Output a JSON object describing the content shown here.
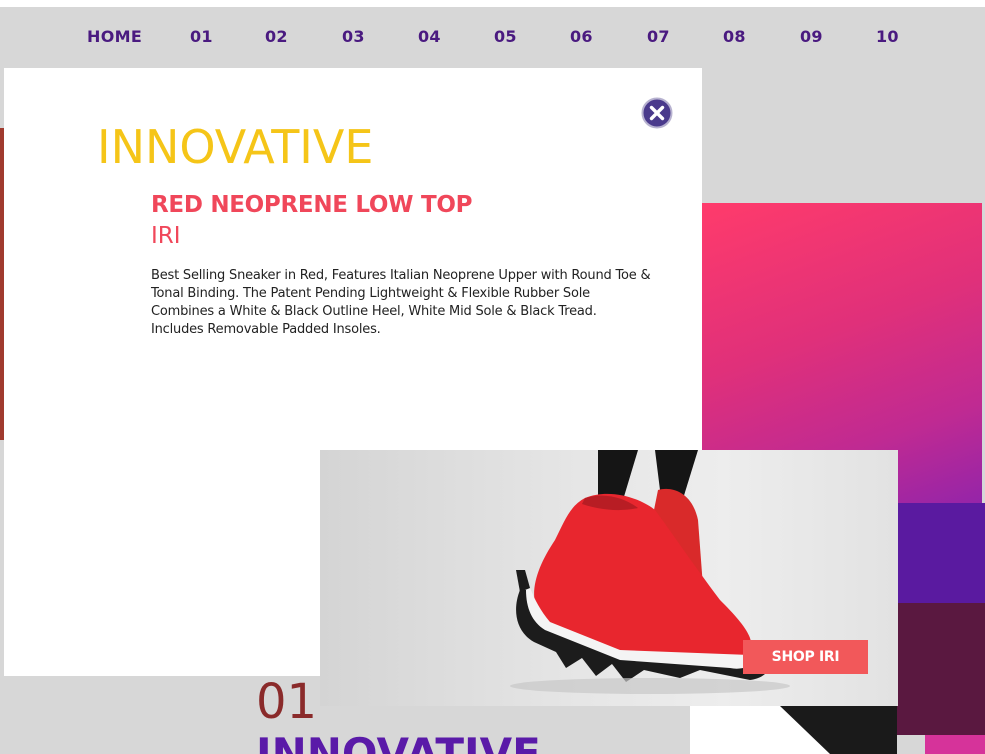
{
  "nav": {
    "items": [
      {
        "label": "HOME"
      },
      {
        "label": "01"
      },
      {
        "label": "02"
      },
      {
        "label": "03"
      },
      {
        "label": "04"
      },
      {
        "label": "05"
      },
      {
        "label": "06"
      },
      {
        "label": "07"
      },
      {
        "label": "08"
      },
      {
        "label": "09"
      },
      {
        "label": "10"
      }
    ]
  },
  "modal": {
    "heading": "INNOVATIVE",
    "product_title": "RED NEOPRENE LOW TOP",
    "product_subtitle": "IRI",
    "description": "Best Selling Sneaker in Red, Features Italian Neoprene Upper with Round Toe & Tonal Binding. The Patent Pending Lightweight & Flexible Rubber Sole Combines a White & Black Outline Heel, White Mid Sole & Black Tread. Includes Removable Padded Insoles.",
    "close_icon": "close-icon",
    "shop_button": "SHOP IRI"
  },
  "section": {
    "number": "01",
    "title": "INNOVATIVE"
  },
  "colors": {
    "nav_text": "#4a1a80",
    "heading": "#f5c518",
    "product": "#f0475a",
    "shop_button": "#f2585a",
    "section_title": "#5a1aa8"
  }
}
